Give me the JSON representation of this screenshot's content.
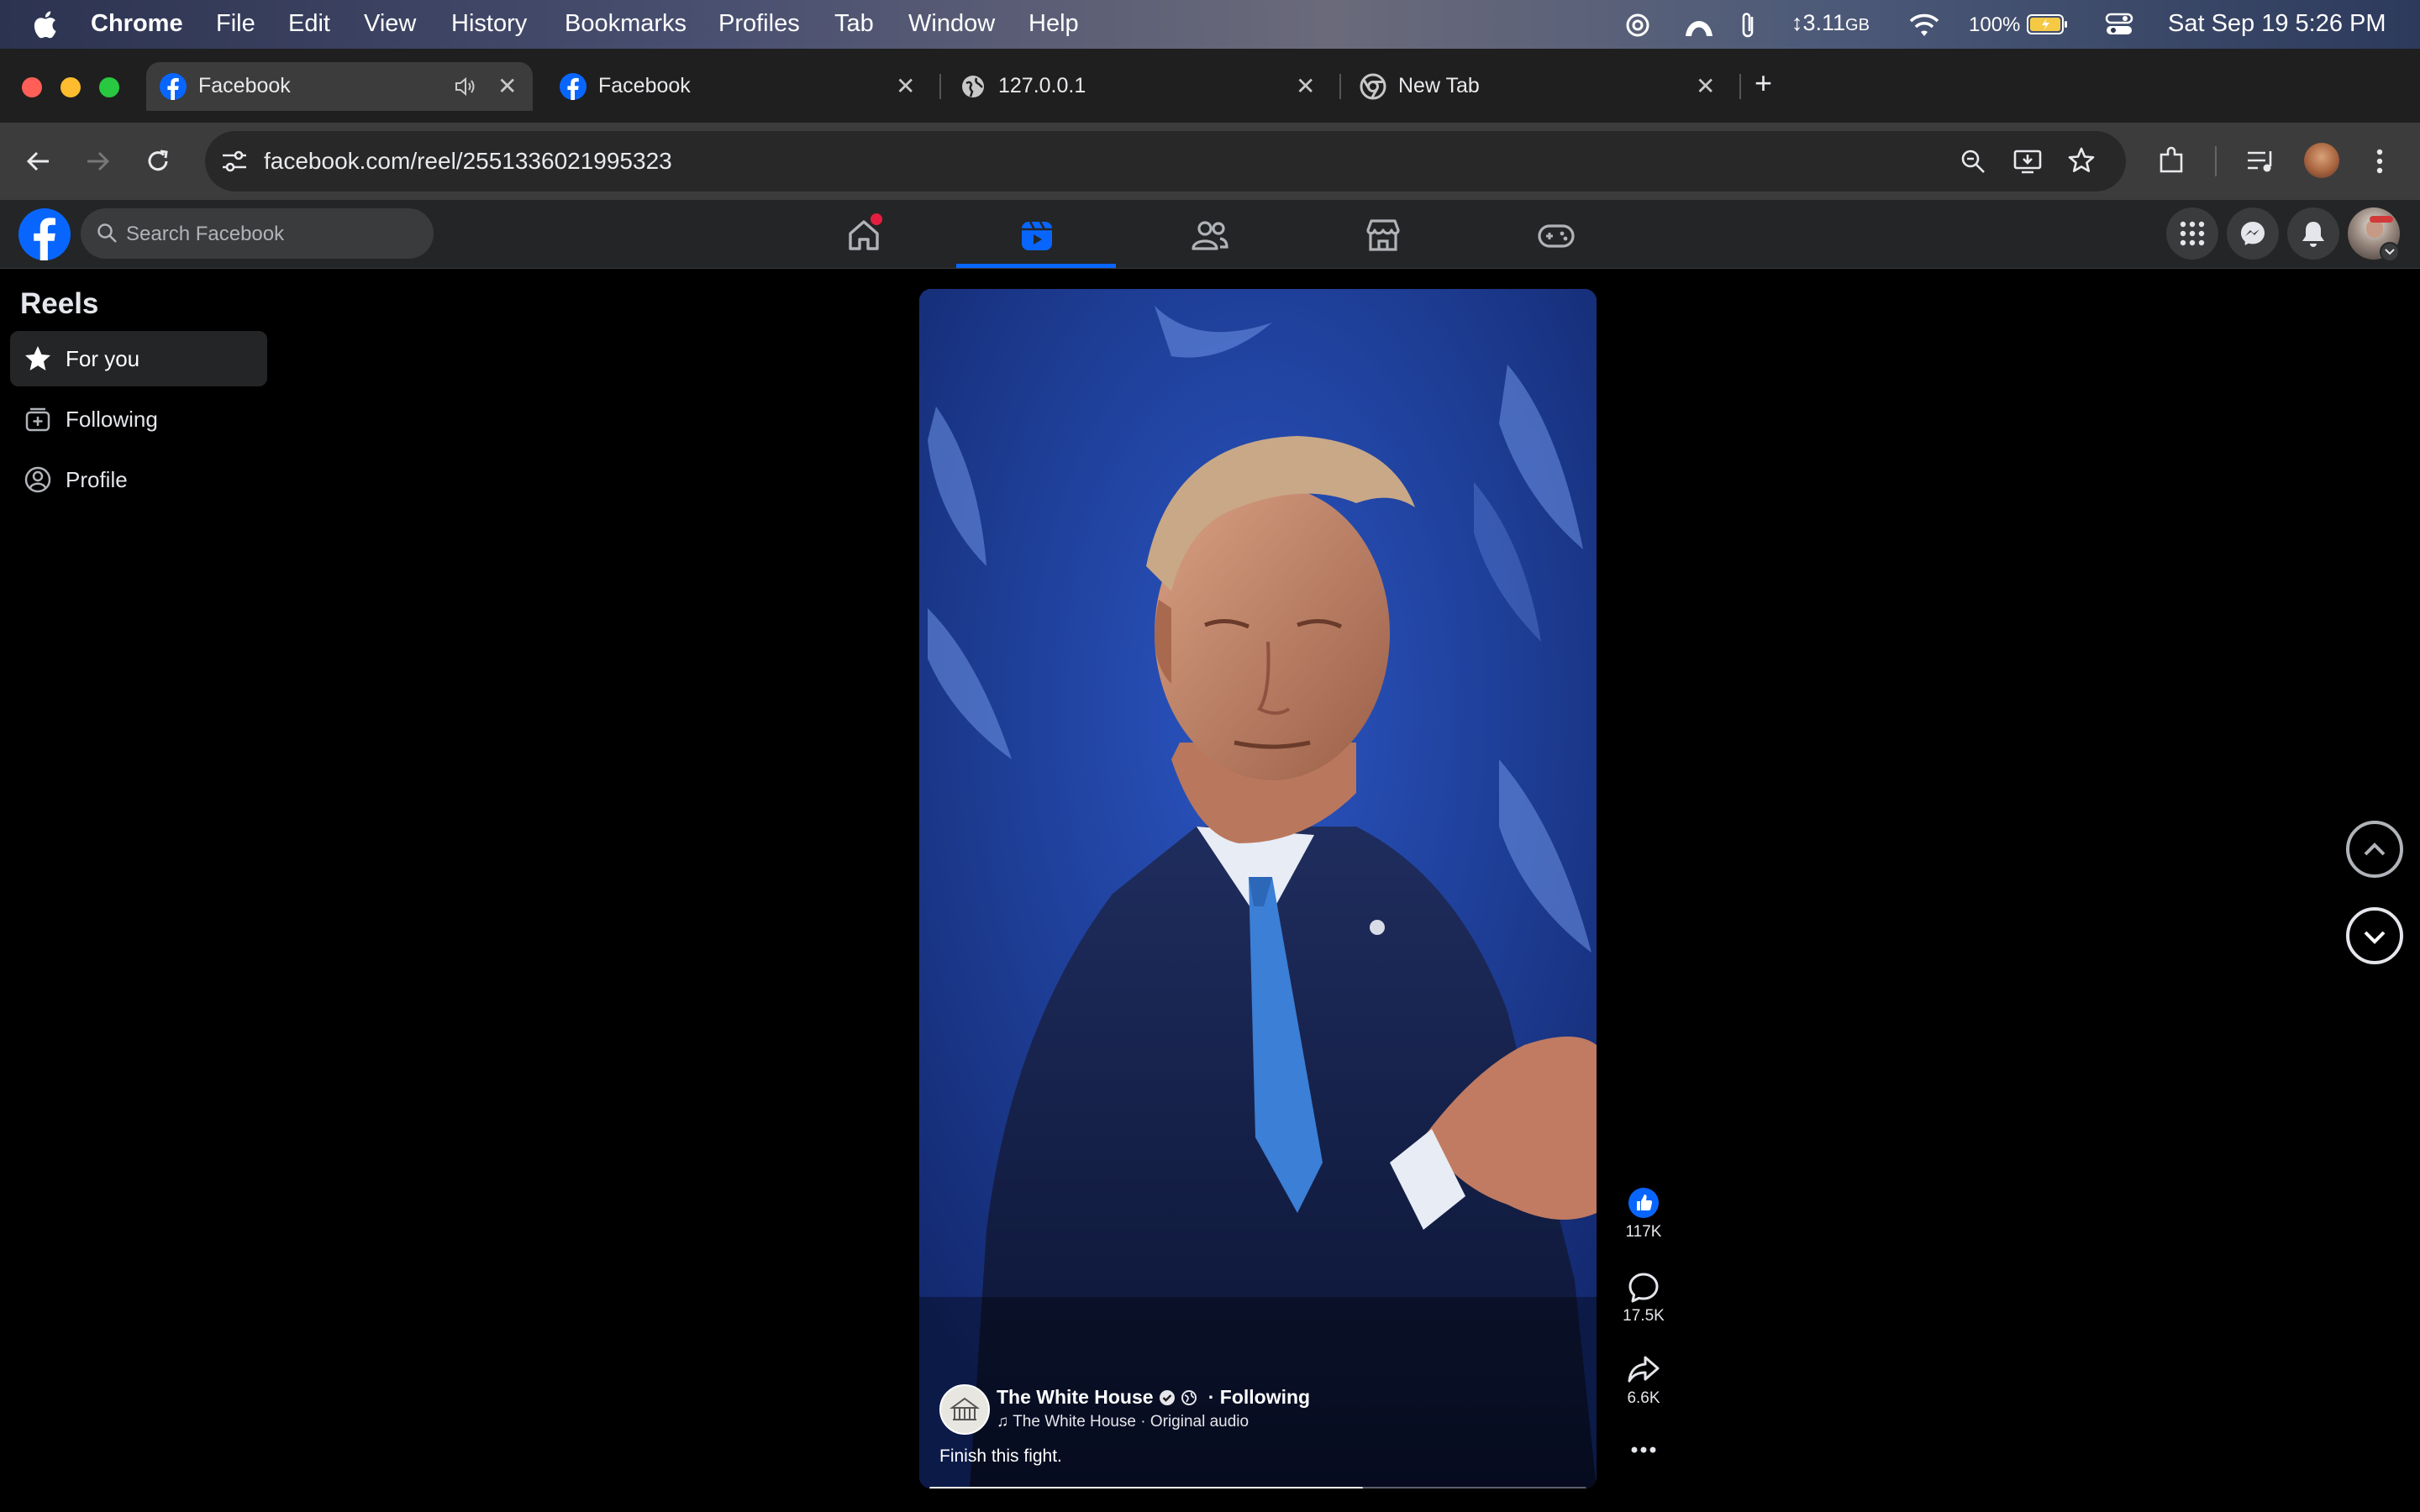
{
  "menubar": {
    "app": "Chrome",
    "items": [
      "File",
      "Edit",
      "View",
      "History",
      "Bookmarks",
      "Profiles",
      "Tab",
      "Window",
      "Help"
    ],
    "memory": "3.11",
    "memory_unit": "GB",
    "battery": "100%",
    "datetime": "Sat Sep 19  5:26 PM"
  },
  "tabs": [
    {
      "title": "Facebook",
      "favicon": "facebook-icon",
      "audio": true,
      "active": true
    },
    {
      "title": "Facebook",
      "favicon": "facebook-icon",
      "active": false
    },
    {
      "title": "127.0.0.1",
      "favicon": "globe-icon",
      "active": false
    },
    {
      "title": "New Tab",
      "favicon": "chrome-icon",
      "active": false
    }
  ],
  "address_bar": {
    "url": "facebook.com/reel/2551336021995323"
  },
  "facebook": {
    "search_placeholder": "Search Facebook",
    "nav": [
      "home-icon",
      "reels-icon",
      "friends-icon",
      "marketplace-icon",
      "gaming-icon"
    ],
    "active_nav": "reels-icon"
  },
  "sidebar": {
    "title": "Reels",
    "items": [
      {
        "label": "For you",
        "icon": "star-icon",
        "selected": true
      },
      {
        "label": "Following",
        "icon": "following-icon",
        "selected": false
      },
      {
        "label": "Profile",
        "icon": "profile-icon",
        "selected": false
      }
    ]
  },
  "reel": {
    "author": "The White House",
    "follow_status": "· Following",
    "audio": "The White House · Original audio",
    "caption": "Finish this fight.",
    "progress": 0.66,
    "likes": "117K",
    "comments": "17.5K",
    "shares": "6.6K"
  },
  "colors": {
    "accent": "#0866ff",
    "fb_bg": "#242526",
    "page_bg": "#000000"
  }
}
